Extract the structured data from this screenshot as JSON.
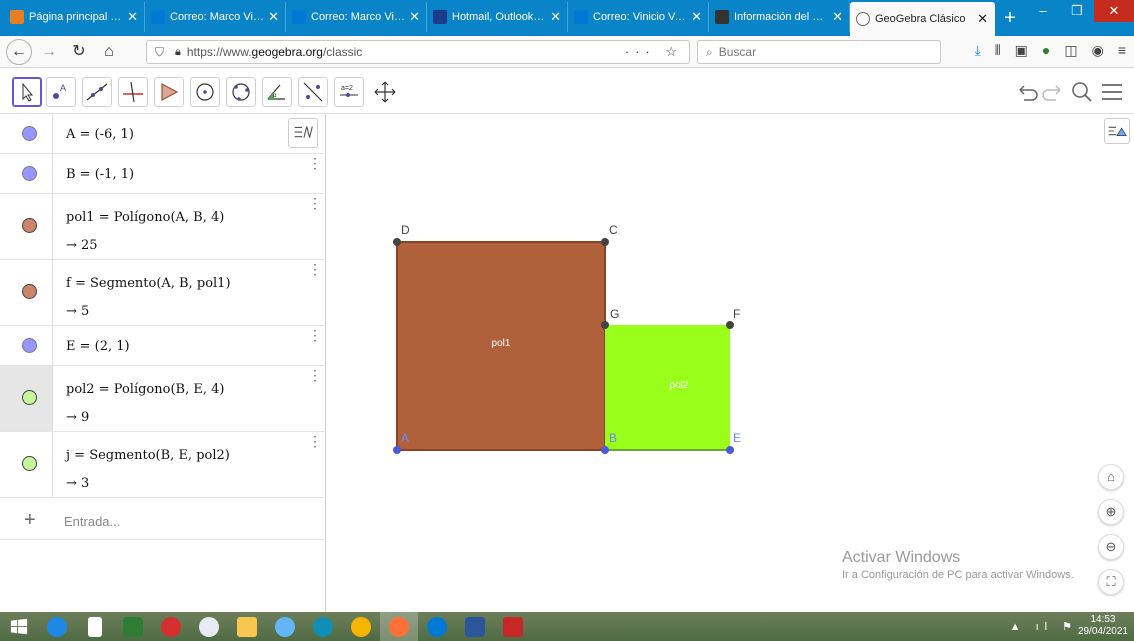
{
  "browser": {
    "tabs": [
      {
        "title": "Página principal del",
        "favicon_color": "#e67e22"
      },
      {
        "title": "Correo: Marco Vinicio",
        "favicon_color": "#0078d4"
      },
      {
        "title": "Correo: Marco Vinicio",
        "favicon_color": "#0078d4"
      },
      {
        "title": "Hotmail, Outlook, Si",
        "favicon_color": "#1e3a8a"
      },
      {
        "title": "Correo: Vinicio Vasq",
        "favicon_color": "#0078d4"
      },
      {
        "title": "Información del Pro",
        "favicon_color": "#333333"
      },
      {
        "title": "GeoGebra Clásico",
        "favicon_color": "#666666",
        "active": true
      }
    ],
    "url_prefix": "https://www.",
    "url_domain": "geogebra.org",
    "url_path": "/classic",
    "search_placeholder": "Buscar",
    "url_actions": "··· ☆"
  },
  "ggb": {
    "tools": [
      "move",
      "point",
      "line",
      "perpendicular",
      "polygon",
      "circle-center",
      "circle-3pts",
      "angle",
      "reflect",
      "slider",
      "move-graphics"
    ],
    "slider_label": "a=2"
  },
  "algebra": {
    "rows": [
      {
        "expr": "A = (-6, 1)",
        "value": "",
        "color": "#6a6aff"
      },
      {
        "expr": "B = (-1, 1)",
        "value": "",
        "color": "#6a6aff"
      },
      {
        "expr": "pol1 = Polígono(A, B, 4)",
        "value": "→ 25",
        "color": "#b0603a"
      },
      {
        "expr": "f = Segmento(A, B, pol1)",
        "value": "→ 5",
        "color": "#b0603a"
      },
      {
        "expr": "E = (2, 1)",
        "value": "",
        "color": "#6a6aff"
      },
      {
        "expr": "pol2 = Polígono(B, E, 4)",
        "value": "→ 9",
        "color": "#99ff33",
        "active": true
      },
      {
        "expr": "j = Segmento(B, E, pol2)",
        "value": "→ 3",
        "color": "#99ff33"
      }
    ],
    "input_placeholder": "Entrada..."
  },
  "graphics": {
    "points": {
      "A": "A",
      "B": "B",
      "C": "C",
      "D": "D",
      "E": "E",
      "F": "F",
      "G": "G"
    },
    "pol1_label": "pol1",
    "pol2_label": "pol2",
    "pol1_color": "#b0603a",
    "pol2_color": "#99ff1a",
    "watermark_title": "Activar Windows",
    "watermark_sub": "Ir a Configuración de PC para activar Windows."
  },
  "taskbar": {
    "time": "14:53",
    "date": "29/04/2021"
  }
}
